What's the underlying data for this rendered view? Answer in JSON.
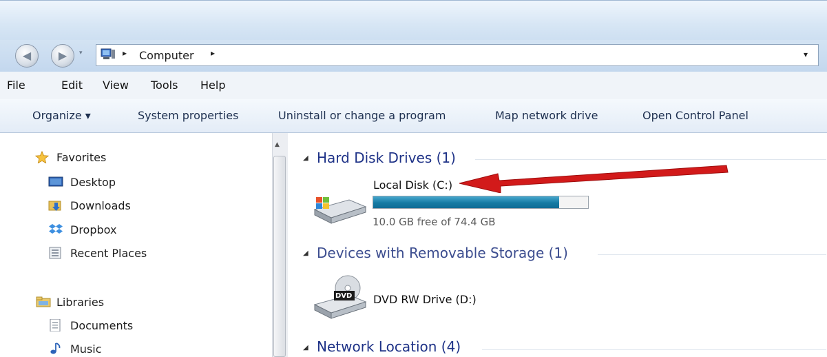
{
  "address": {
    "location": "Computer",
    "separator": "▸",
    "dropdown": "▾"
  },
  "nav_buttons": {
    "back": "◀",
    "forward": "▶",
    "recent": "▾"
  },
  "menu": [
    "File",
    "Edit",
    "View",
    "Tools",
    "Help"
  ],
  "toolbar": {
    "organize": "Organize ▾",
    "system_properties": "System properties",
    "uninstall": "Uninstall or change a program",
    "map_drive": "Map network drive",
    "control_panel": "Open Control Panel"
  },
  "nav": {
    "favorites": {
      "label": "Favorites",
      "icon": "star-icon"
    },
    "favorites_items": [
      {
        "label": "Desktop",
        "icon": "desktop-icon"
      },
      {
        "label": "Downloads",
        "icon": "downloads-icon"
      },
      {
        "label": "Dropbox",
        "icon": "dropbox-icon"
      },
      {
        "label": "Recent Places",
        "icon": "recent-places-icon"
      }
    ],
    "libraries": {
      "label": "Libraries",
      "icon": "libraries-icon"
    },
    "libraries_items": [
      {
        "label": "Documents",
        "icon": "documents-icon"
      },
      {
        "label": "Music",
        "icon": "music-icon"
      }
    ]
  },
  "groups": {
    "hard_disk": "Hard Disk Drives (1)",
    "removable": "Devices with Removable Storage (1)",
    "network": "Network Location (4)"
  },
  "drives": {
    "c": {
      "name": "Local Disk (C:)",
      "free_text": "10.0 GB free of 74.4 GB",
      "used_fraction": 0.866
    },
    "d": {
      "name": "DVD RW Drive (D:)",
      "badge": "DVD"
    }
  },
  "colors": {
    "accent_header": "#1e3287",
    "bar_fill": "#1a7fa8",
    "arrow": "#d21a1a"
  }
}
